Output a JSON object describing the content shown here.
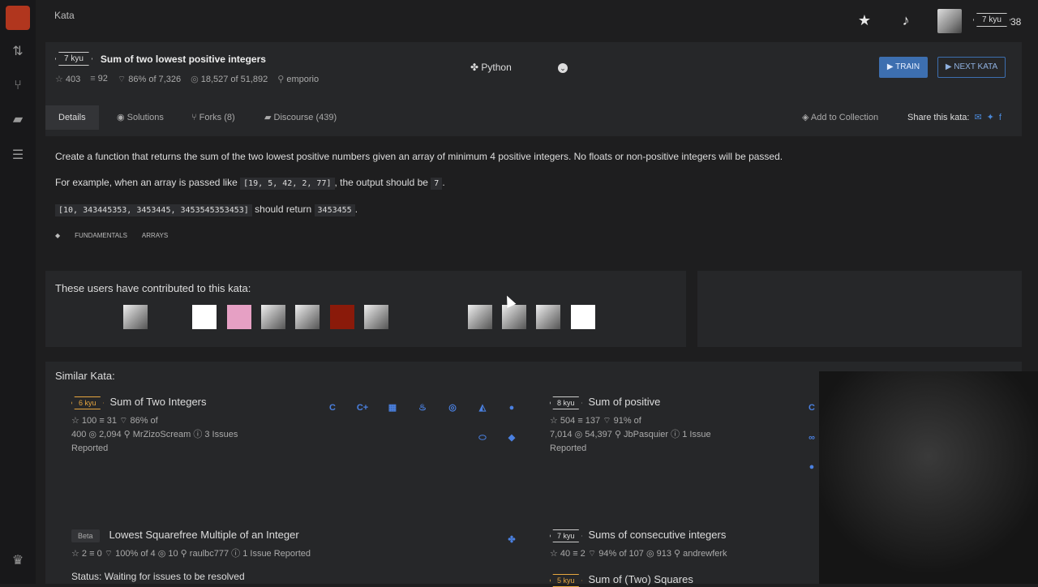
{
  "topbar": {
    "breadcrumb": "Kata",
    "rank": "7 kyu",
    "honor": "38"
  },
  "kata": {
    "rank": "7 kyu",
    "title": "Sum of two lowest positive integers",
    "stars": "403",
    "collections": "92",
    "satisfaction": "86% of 7,326",
    "completions": "18,527 of 51,892",
    "author": "emporio",
    "language": "Python",
    "train_label": "▶ TRAIN",
    "next_label": "▶ NEXT KATA"
  },
  "tabs": {
    "details": "Details",
    "solutions": "Solutions",
    "forks": "Forks (8)",
    "discourse": "Discourse (439)",
    "add_collection": "Add to Collection",
    "share": "Share this kata:"
  },
  "description": {
    "p1": "Create a function that returns the sum of the two lowest positive numbers given an array of minimum 4 positive integers. No floats or non-positive integers will be passed.",
    "p2_pre": "For example, when an array is passed like",
    "p2_code": "[19, 5, 42, 2, 77]",
    "p2_mid": ", the output should be",
    "p2_code2": "7",
    "p2_end": ".",
    "p3_code": "[10, 343445353, 3453445, 3453545353453]",
    "p3_mid": " should return ",
    "p3_code2": "3453455",
    "p3_end": ".",
    "tags": [
      "FUNDAMENTALS",
      "ARRAYS"
    ]
  },
  "contributors": {
    "title": "These users have contributed to this kata:"
  },
  "similar": {
    "title": "Similar Kata:",
    "items": [
      {
        "rank": "6 kyu",
        "name": "Sum of Two Integers",
        "line1": "☆ 100  ≡ 31  ⌔ 86% of",
        "line2": "400  ◎ 2,094  ⚲ MrZizoScream  ⓘ 3 Issues",
        "line3": "Reported"
      },
      {
        "rank": "8 kyu",
        "name": "Sum of positive",
        "line1": "☆ 504  ≡ 137  ⌔ 91% of",
        "line2": "7,014  ◎ 54,397  ⚲ JbPasquier  ⓘ 1 Issue",
        "line3": "Reported"
      },
      {
        "rank": "Beta",
        "name": "Lowest Squarefree Multiple of an Integer",
        "line1": "☆ 2  ≡ 0  ⌔ 100% of 4  ◎ 10  ⚲ raulbc777  ⓘ 1 Issue Reported"
      },
      {
        "rank": "7 kyu",
        "name": "Sums of consecutive integers",
        "line1": "☆ 40  ≡ 2  ⌔ 94% of 107  ◎ 913  ⚲ andrewferk"
      },
      {
        "rank": "5 kyu",
        "name": "Sum of (Two) Squares"
      }
    ],
    "status": "Status:  Waiting for issues to be resolved"
  }
}
